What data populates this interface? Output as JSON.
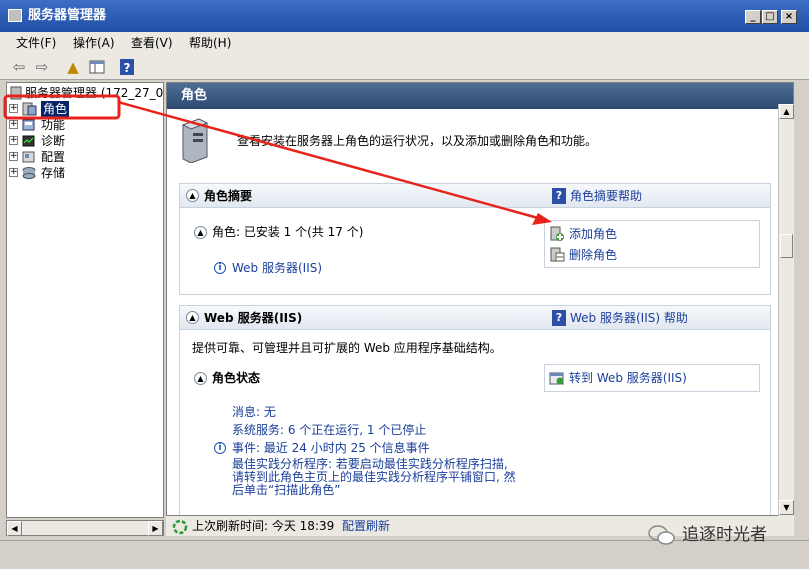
{
  "window": {
    "title": "服务器管理器"
  },
  "menu": {
    "items": [
      "文件(F)",
      "操作(A)",
      "查看(V)",
      "帮助(H)"
    ]
  },
  "tree": {
    "root": "服务器管理器 (172_27_0_",
    "items": [
      {
        "label": "角色",
        "icon": "roles-icon",
        "selected": true
      },
      {
        "label": "功能",
        "icon": "features-icon"
      },
      {
        "label": "诊断",
        "icon": "diagnostics-icon"
      },
      {
        "label": "配置",
        "icon": "configuration-icon"
      },
      {
        "label": "存储",
        "icon": "storage-icon"
      }
    ]
  },
  "header": {
    "title": "角色"
  },
  "intro": {
    "text": "查看安装在服务器上角色的运行状况，以及添加或删除角色和功能。"
  },
  "roles_summary": {
    "title": "角色摘要",
    "help_link": "角色摘要帮助",
    "roles_label": "角色: 已安装 1 个(共 17 个)",
    "role_item": "Web 服务器(IIS)",
    "add_role": "添加角色",
    "remove_role": "删除角色"
  },
  "web_server": {
    "title": "Web 服务器(IIS)",
    "help_link": "Web 服务器(IIS) 帮助",
    "description": "提供可靠、可管理并且可扩展的 Web 应用程序基础结构。",
    "status_title": "角色状态",
    "goto_link": "转到 Web 服务器(IIS)",
    "messages": "消息: 无",
    "system_services": "系统服务: 6 个正在运行, 1 个已停止",
    "events": "事件: 最近 24 小时内 25 个信息事件",
    "bpa_line1": "最佳实践分析程序: 若要启动最佳实践分析程序扫描,",
    "bpa_line2": "请转到此角色主页上的最佳实践分析程序平铺窗口, 然",
    "bpa_line3": "后单击“扫描此角色”"
  },
  "status": {
    "last_refresh": "上次刷新时间: 今天 18:39",
    "configure_refresh": "配置刷新"
  },
  "watermark": {
    "text": "追逐时光者"
  },
  "colors": {
    "annotation": "#e8231c",
    "link": "#1a3e9a",
    "header": "#3b5a82"
  }
}
